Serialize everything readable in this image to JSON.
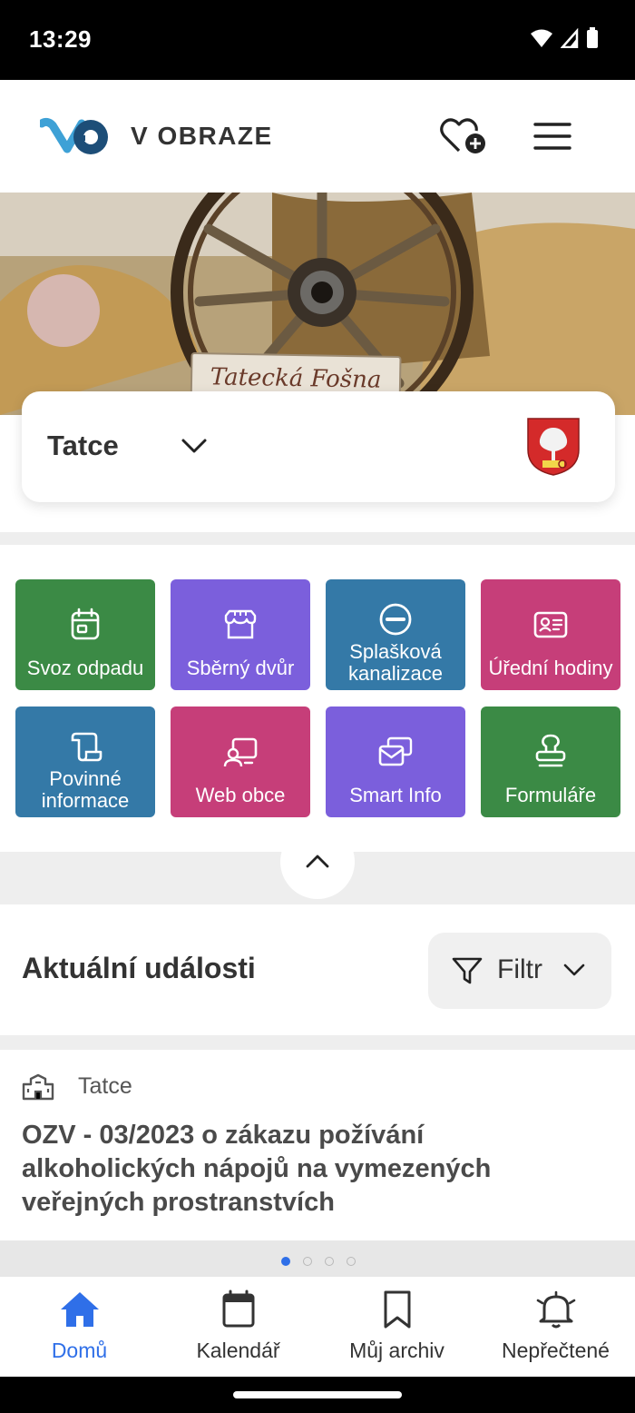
{
  "status": {
    "time": "13:29"
  },
  "header": {
    "app_title": "V OBRAZE"
  },
  "hero": {
    "sign_text": "Tatecká Fošna"
  },
  "location": {
    "name": "Tatce"
  },
  "tiles": [
    {
      "label": "Svoz odpadu",
      "icon": "calendar-icon",
      "color": "#3b8a45"
    },
    {
      "label": "Sběrný dvůr",
      "icon": "store-icon",
      "color": "#7b5fdc"
    },
    {
      "label": "Splašková kanalizace",
      "icon": "no-entry-icon",
      "color": "#3479a7"
    },
    {
      "label": "Úřední hodiny",
      "icon": "id-card-icon",
      "color": "#c63e79"
    },
    {
      "label": "Povinné informace",
      "icon": "scroll-icon",
      "color": "#3479a7"
    },
    {
      "label": "Web obce",
      "icon": "screen-user-icon",
      "color": "#c63e79"
    },
    {
      "label": "Smart Info",
      "icon": "messages-icon",
      "color": "#7b5fdc"
    },
    {
      "label": "Formuláře",
      "icon": "stamp-icon",
      "color": "#3b8a45"
    }
  ],
  "events": {
    "title": "Aktuální události",
    "filter_label": "Filtr",
    "items": [
      {
        "source": "Tatce",
        "title": "OZV - 03/2023 o zákazu požívání alkoholických nápojů na vymezených veřejných prostranstvích"
      }
    ],
    "pager": {
      "count": 4,
      "active": 0
    }
  },
  "bottom_nav": [
    {
      "label": "Domů",
      "icon": "home-icon",
      "active": true
    },
    {
      "label": "Kalendář",
      "icon": "calendar-icon",
      "active": false
    },
    {
      "label": "Můj archiv",
      "icon": "bookmark-icon",
      "active": false
    },
    {
      "label": "Nepřečtené",
      "icon": "bell-icon",
      "active": false
    }
  ],
  "colors": {
    "accent": "#2f6fe8",
    "green": "#3b8a45",
    "purple": "#7b5fdc",
    "blue": "#3479a7",
    "pink": "#c63e79"
  }
}
